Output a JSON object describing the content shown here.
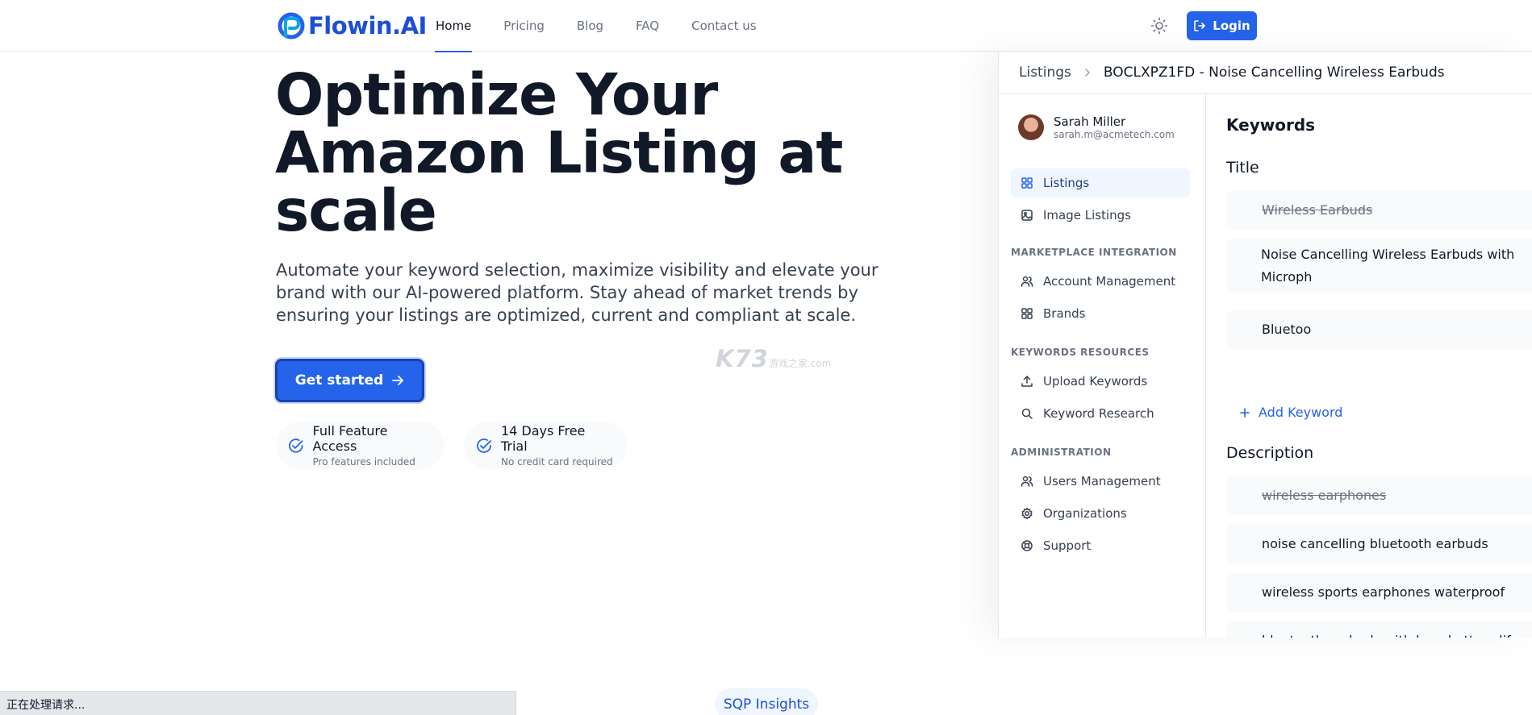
{
  "brand": {
    "name": "Flowin.AI",
    "color": "#2563eb"
  },
  "nav": {
    "links": [
      "Home",
      "Pricing",
      "Blog",
      "FAQ",
      "Contact us"
    ],
    "active": "Home",
    "theme_icon": "sun-icon",
    "login_label": "Login"
  },
  "hero": {
    "title": "Optimize Your Amazon Listing at scale",
    "subtitle": "Automate your keyword selection, maximize visibility and elevate your brand with our AI-powered platform. Stay ahead of market trends by ensuring your listings are optimized, current and compliant at scale.",
    "cta_label": "Get started",
    "badges": [
      {
        "title": "Full Feature Access",
        "caption": "Pro features included"
      },
      {
        "title": "14 Days Free Trial",
        "caption": "No credit card required"
      }
    ]
  },
  "watermark": {
    "main": "K73",
    "sub": "游戏之家",
    "domain": ".com"
  },
  "preview": {
    "breadcrumb": {
      "root": "Listings",
      "current": "BOCLXPZ1FD - Noise Cancelling Wireless Earbuds"
    },
    "user": {
      "name": "Sarah Miller",
      "email": "sarah.m@acmetech.com"
    },
    "menu": {
      "listings": "Listings",
      "image_listings": "Image Listings",
      "marketplace_head": "MARKETPLACE INTEGRATION",
      "account_management": "Account Management",
      "brands": "Brands",
      "keywords_head": "KEYWORDS RESOURCES",
      "upload_keywords": "Upload Keywords",
      "keyword_research": "Keyword Research",
      "admin_head": "ADMINISTRATION",
      "users_management": "Users Management",
      "organizations": "Organizations",
      "support": "Support"
    },
    "keywords": {
      "heading": "Keywords",
      "title_label": "Title",
      "title_items": [
        "Wireless Earbuds",
        "Noise Cancelling Wireless Earbuds with Microph",
        "Bluetoo"
      ],
      "add_label": "Add Keyword",
      "description_label": "Description",
      "description_items": [
        "wireless earphones",
        "noise cancelling bluetooth earbuds",
        "wireless sports earphones waterproof",
        "bluetooth earbuds with long battery life"
      ]
    }
  },
  "footer": {
    "status_text": "正在处理请求...",
    "pill_label": "SQP Insights"
  }
}
